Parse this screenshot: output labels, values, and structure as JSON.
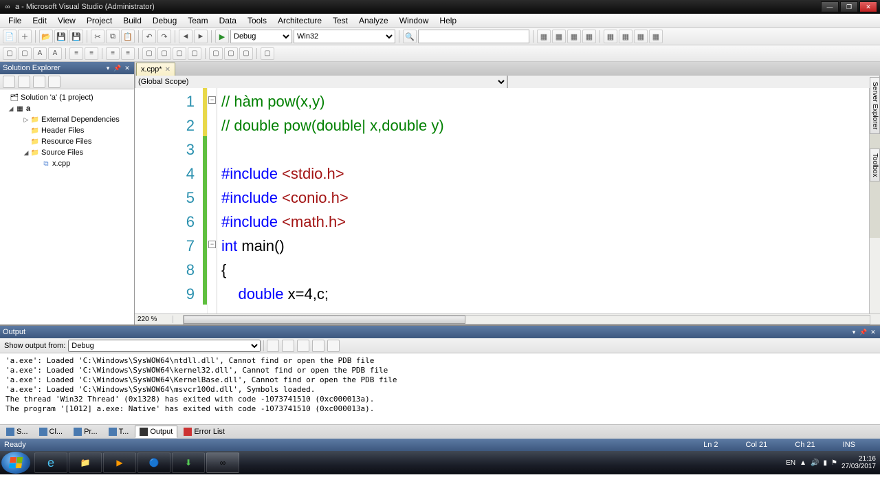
{
  "title": "a - Microsoft Visual Studio (Administrator)",
  "menu": [
    "File",
    "Edit",
    "View",
    "Project",
    "Build",
    "Debug",
    "Team",
    "Data",
    "Tools",
    "Architecture",
    "Test",
    "Analyze",
    "Window",
    "Help"
  ],
  "config": "Debug",
  "platform": "Win32",
  "solExp": {
    "title": "Solution Explorer",
    "solution": "Solution 'a' (1 project)",
    "project": "a",
    "folders": [
      "External Dependencies",
      "Header Files",
      "Resource Files",
      "Source Files"
    ],
    "file": "x.cpp"
  },
  "tab": {
    "name": "x.cpp*"
  },
  "scope": "(Global Scope)",
  "zoom": "220 %",
  "code": {
    "l1": {
      "a": "// h",
      "b": "à",
      "c": "m pow(x,y)"
    },
    "l2": "// double pow(double| x,double y)",
    "l4_kw": "#include ",
    "l4_h": "<stdio.h>",
    "l5_kw": "#include ",
    "l5_h": "<conio.h>",
    "l6_kw": "#include ",
    "l6_h": "<math.h>",
    "l7_kw": "int ",
    "l7_r": "main()",
    "l8": "{",
    "l9_pad": "    ",
    "l9_kw": "double ",
    "l9_r": "x=4,c;"
  },
  "output": {
    "title": "Output",
    "label": "Show output from:",
    "source": "Debug",
    "lines": "'a.exe': Loaded 'C:\\Windows\\SysWOW64\\ntdll.dll', Cannot find or open the PDB file\n'a.exe': Loaded 'C:\\Windows\\SysWOW64\\kernel32.dll', Cannot find or open the PDB file\n'a.exe': Loaded 'C:\\Windows\\SysWOW64\\KernelBase.dll', Cannot find or open the PDB file\n'a.exe': Loaded 'C:\\Windows\\SysWOW64\\msvcr100d.dll', Symbols loaded.\nThe thread 'Win32 Thread' (0x1328) has exited with code -1073741510 (0xc000013a).\nThe program '[1012] a.exe: Native' has exited with code -1073741510 (0xc000013a)."
  },
  "bottomTabs": {
    "s": "S...",
    "cl": "Cl...",
    "pr": "Pr...",
    "t": "T...",
    "out": "Output",
    "err": "Error List"
  },
  "status": {
    "ready": "Ready",
    "ln": "Ln 2",
    "col": "Col 21",
    "ch": "Ch 21",
    "ins": "INS"
  },
  "sidetabs": "Server Explorer",
  "sidetabs2": "Toolbox",
  "tray": {
    "lang": "EN",
    "time": "21:16",
    "date": "27/03/2017"
  }
}
